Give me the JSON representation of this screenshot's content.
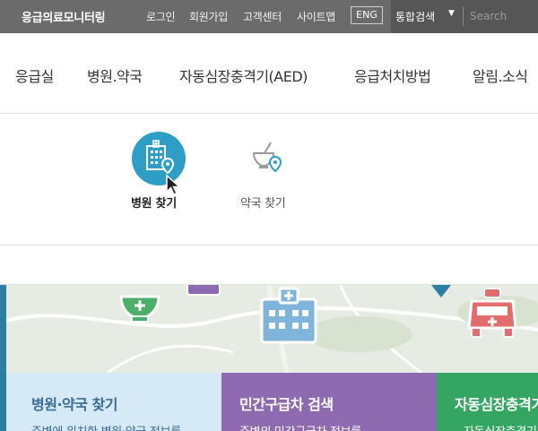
{
  "topbar": {
    "brand": "응급의료모니터링",
    "login": "로그인",
    "signup": "회원가입",
    "support": "고객센터",
    "sitemap": "사이트맵",
    "eng": "ENG",
    "search_label": "통합검색",
    "search_placeholder": "Search"
  },
  "nav": {
    "items": [
      {
        "label": "응급실"
      },
      {
        "label": "병원.약국"
      },
      {
        "label": "자동심장충격기(AED)"
      },
      {
        "label": "응급처치방법"
      },
      {
        "label": "알림.소식"
      }
    ]
  },
  "dropdown": {
    "hospital_label": "병원 찾기",
    "pharmacy_label": "약국 찾기",
    "active_color": "#2e9ec6"
  },
  "cards": [
    {
      "title": "병원·약국 찾기",
      "desc": "주변에 위치한 병원·약국 정보를",
      "bg": "#d6e9f7",
      "color": "#3b6c95"
    },
    {
      "title": "민간구급차 검색",
      "desc": "주변의 민간구급차 정보를",
      "bg": "#8e6bb0",
      "color": "#ffffff"
    },
    {
      "title": "자동심장충격기",
      "desc": "자동심장충격기",
      "bg": "#34a562",
      "color": "#ffffff"
    }
  ]
}
